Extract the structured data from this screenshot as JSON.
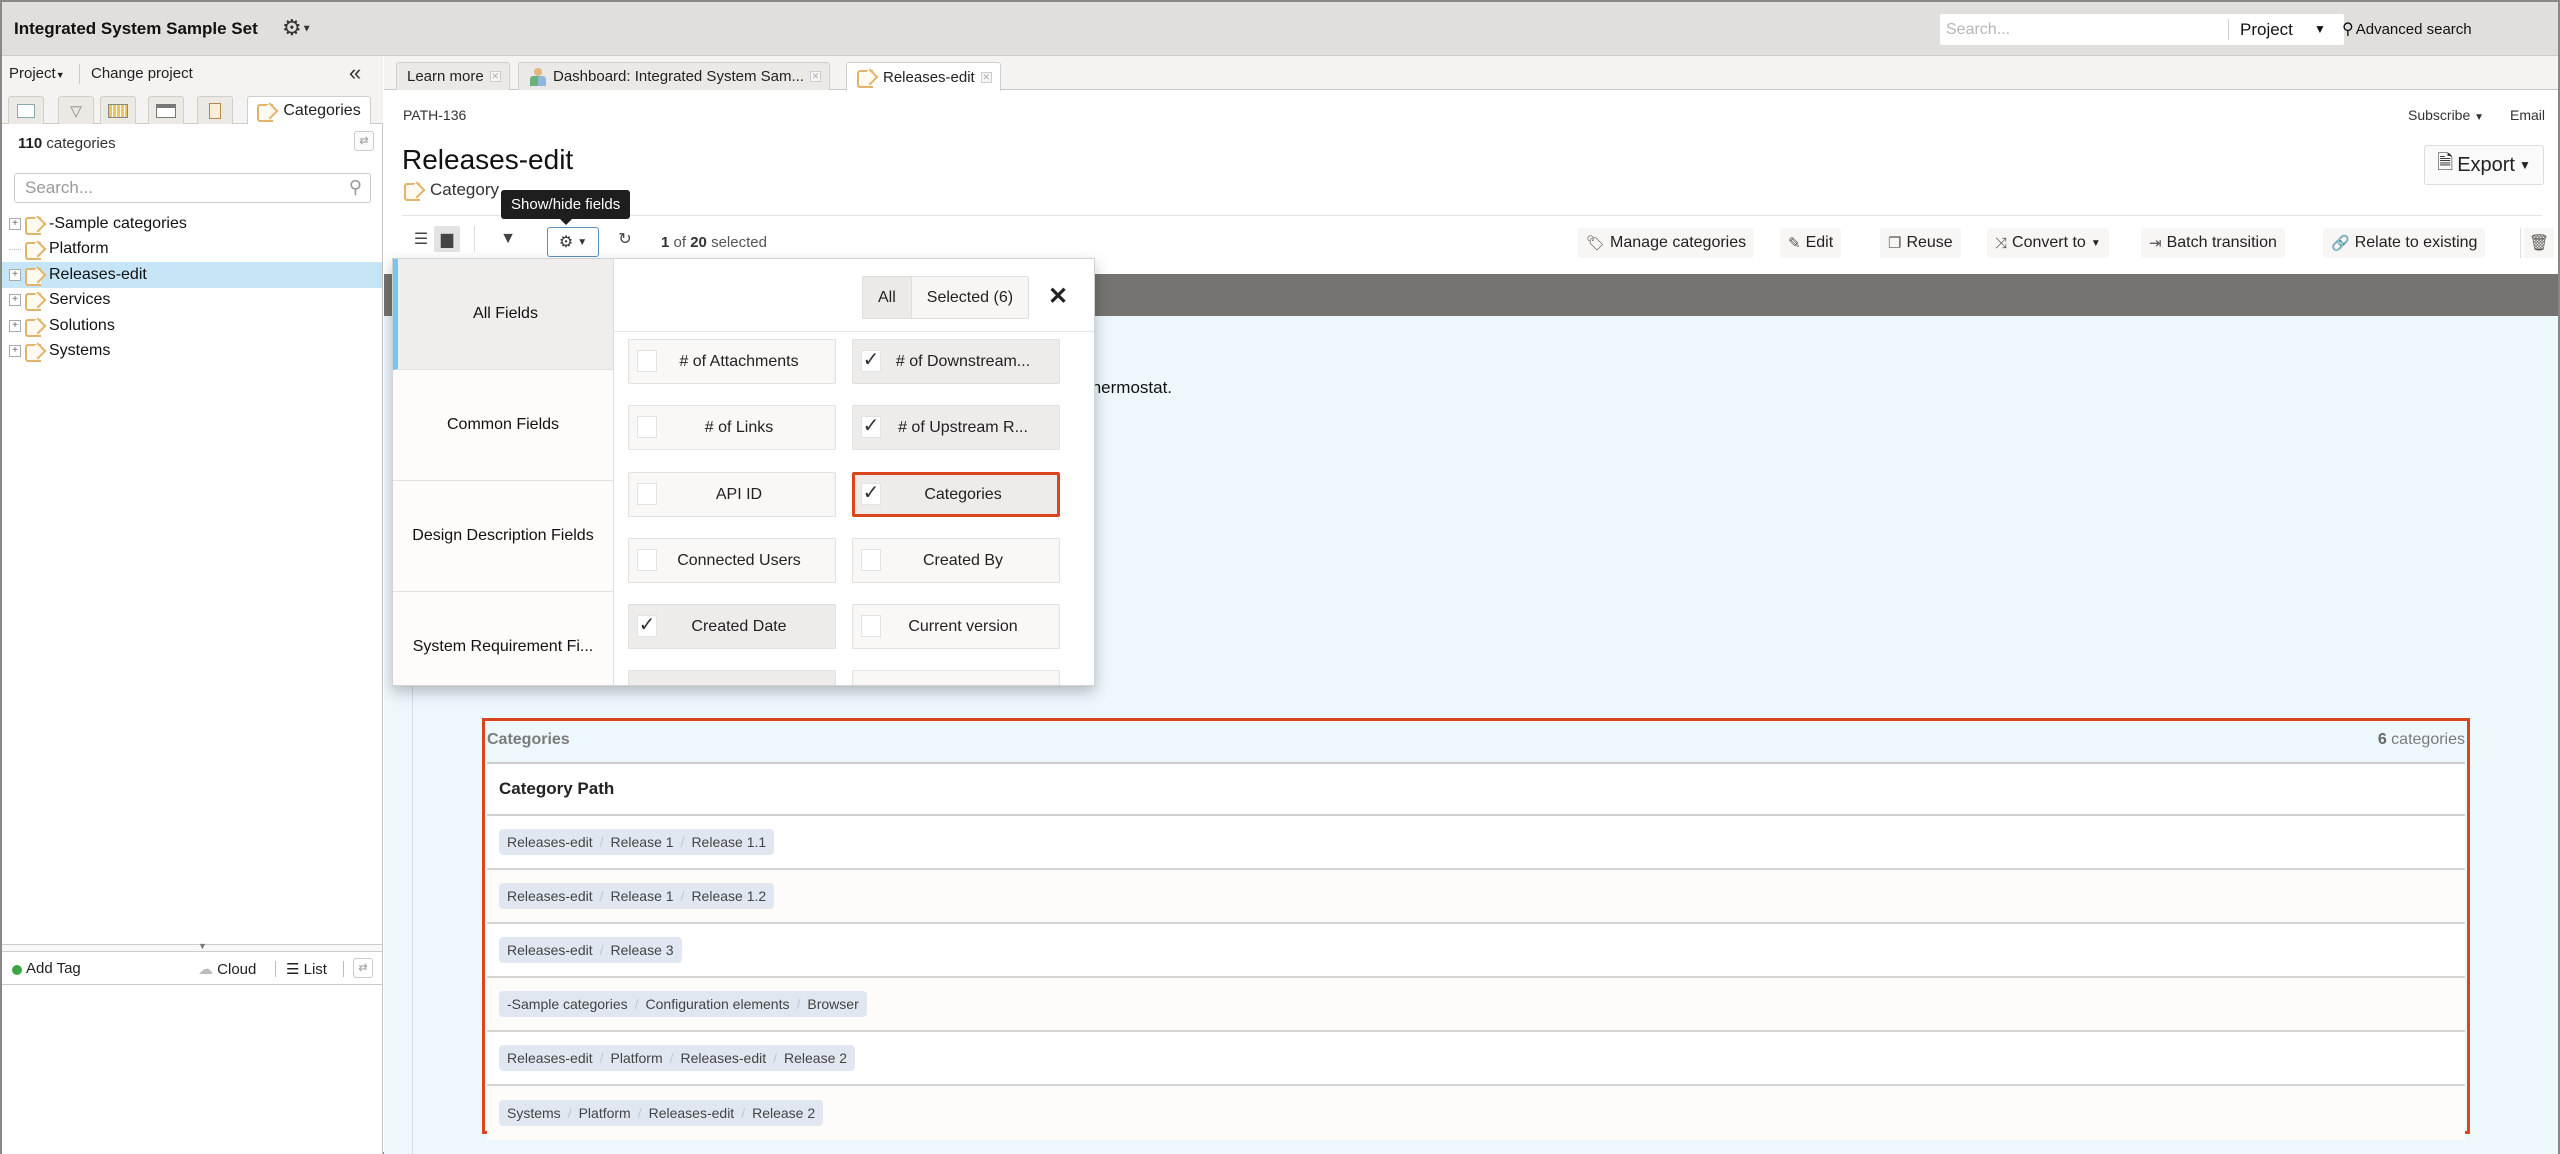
{
  "app": {
    "title": "Integrated System Sample Set",
    "settings_icon": "gear-icon",
    "search_placeholder": "Search...",
    "search_scope": "Project",
    "advanced_search": "Advanced search"
  },
  "sidebar": {
    "project_menu": "Project",
    "change_project": "Change project",
    "collapse_icon": "double-chevron-left-icon",
    "tabs": [
      {
        "icon": "explorer-icon"
      },
      {
        "icon": "filter-icon"
      },
      {
        "icon": "release-icon"
      },
      {
        "icon": "window-icon"
      },
      {
        "icon": "clipboard-icon"
      },
      {
        "icon": "tag-icon",
        "label": "Categories"
      }
    ],
    "count_number": "110",
    "count_label": "categories",
    "search_placeholder": "Search...",
    "tree": [
      {
        "label": "-Sample categories",
        "expandable": true,
        "selected": false
      },
      {
        "label": "Platform",
        "expandable": false,
        "selected": false
      },
      {
        "label": "Releases-edit",
        "expandable": true,
        "selected": true
      },
      {
        "label": "Services",
        "expandable": true,
        "selected": false
      },
      {
        "label": "Solutions",
        "expandable": true,
        "selected": false
      },
      {
        "label": "Systems",
        "expandable": true,
        "selected": false
      }
    ],
    "tag_toolbar": {
      "add_tag": "Add Tag",
      "cloud": "Cloud",
      "list": "List"
    }
  },
  "tabs": [
    {
      "label": "Learn more",
      "icon": "",
      "active": false
    },
    {
      "label": "Dashboard: Integrated System Sam...",
      "icon": "dashboard-icon",
      "active": false
    },
    {
      "label": "Releases-edit",
      "icon": "tag-icon",
      "active": true
    }
  ],
  "item": {
    "id": "PATH-136",
    "title": "Releases-edit",
    "type": "Category",
    "subscribe": "Subscribe",
    "email": "Email",
    "export": "Export"
  },
  "toolbar": {
    "tooltip": "Show/hide fields",
    "selection_current": "1",
    "selection_of": "of",
    "selection_total": "20",
    "selection_suffix": "selected",
    "actions": [
      {
        "label": "Manage categories",
        "icon": "tag-icon"
      },
      {
        "label": "Edit",
        "icon": "pencil-icon"
      },
      {
        "label": "Reuse",
        "icon": "copy-icon"
      },
      {
        "label": "Convert to",
        "icon": "shuffle-icon",
        "dropdown": true
      },
      {
        "label": "Batch transition",
        "icon": "transition-icon"
      },
      {
        "label": "Relate to existing",
        "icon": "link-icon"
      }
    ]
  },
  "content": {
    "description_fragment": "thermostat."
  },
  "fields_popover": {
    "nav": [
      "All Fields",
      "Common Fields",
      "Design Description Fields",
      "System Requirement Fi..."
    ],
    "active_nav": "All Fields",
    "filter_all": "All",
    "filter_selected": "Selected (6)",
    "fields": [
      {
        "label": "# of Attachments",
        "checked": false
      },
      {
        "label": "# of Downstream...",
        "checked": true
      },
      {
        "label": "# of Links",
        "checked": false
      },
      {
        "label": "# of Upstream R...",
        "checked": true
      },
      {
        "label": "API ID",
        "checked": false
      },
      {
        "label": "Categories",
        "checked": true,
        "highlighted": true
      },
      {
        "label": "Connected Users",
        "checked": false
      },
      {
        "label": "Created By",
        "checked": false
      },
      {
        "label": "Created Date",
        "checked": true
      },
      {
        "label": "Current version",
        "checked": false
      }
    ]
  },
  "categories_panel": {
    "title": "Categories",
    "count_number": "6",
    "count_label": "categories",
    "column_header": "Category Path",
    "rows": [
      [
        "Releases-edit",
        "Release 1",
        "Release 1.1"
      ],
      [
        "Releases-edit",
        "Release 1",
        "Release 1.2"
      ],
      [
        "Releases-edit",
        "Release 3"
      ],
      [
        "-Sample categories",
        "Configuration elements",
        "Browser"
      ],
      [
        "Releases-edit",
        "Platform",
        "Releases-edit",
        "Release 2"
      ],
      [
        "Systems",
        "Platform",
        "Releases-edit",
        "Release 2"
      ]
    ]
  },
  "colors": {
    "highlight_border": "#d9461e",
    "selected_tree_bg": "#c6e6f8",
    "content_bg": "#edf8fd",
    "grey_band": "#767470",
    "crumb_bg": "#e1e7f1"
  }
}
